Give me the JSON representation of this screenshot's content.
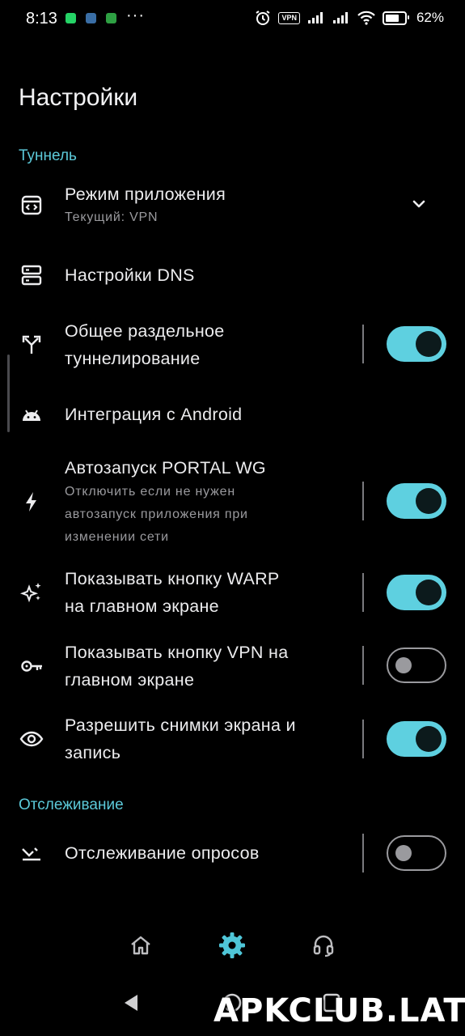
{
  "status_bar": {
    "time": "8:13",
    "dots": "···",
    "vpn": "VPN",
    "battery": "62%"
  },
  "header": {
    "title": "Настройки"
  },
  "sections": [
    {
      "header": "Туннель"
    },
    {
      "header": "Отслеживание"
    }
  ],
  "rows": [
    {
      "title": "Режим приложения",
      "subtitle": "Текущий: VPN",
      "icon": "code-window-icon",
      "control": "chevron-down"
    },
    {
      "title": "Настройки DNS",
      "icon": "server-icon"
    },
    {
      "title": "Общее раздельное\nтуннелирование",
      "icon": "split-arrows-icon",
      "toggle": true
    },
    {
      "title": "Интеграция с Android",
      "icon": "android-icon"
    },
    {
      "title": "Автозапуск PORTAL WG",
      "subtitle": "Отключить если не нужен\nавтозапуск приложения при\nизменении сети",
      "icon": "bolt-icon",
      "toggle": true
    },
    {
      "title": "Показывать кнопку WARP\nна главном экране",
      "icon": "sparkle-icon",
      "toggle": true
    },
    {
      "title": "Показывать кнопку VPN на\nглавном экране",
      "icon": "key-icon",
      "toggle": false
    },
    {
      "title": "Разрешить снимки экрана и\nзапись",
      "icon": "eye-icon",
      "toggle": true
    },
    {
      "title": "Отслеживание опросов",
      "icon": "tracking-icon",
      "toggle": false
    }
  ],
  "bottom_nav": [
    "home-icon",
    "settings-gear-icon",
    "support-headset-icon"
  ],
  "watermark": "APKCLUB.LAT",
  "colors": {
    "accent": "#5ed0e0",
    "section": "#5cc9d9",
    "background": "#000000"
  }
}
